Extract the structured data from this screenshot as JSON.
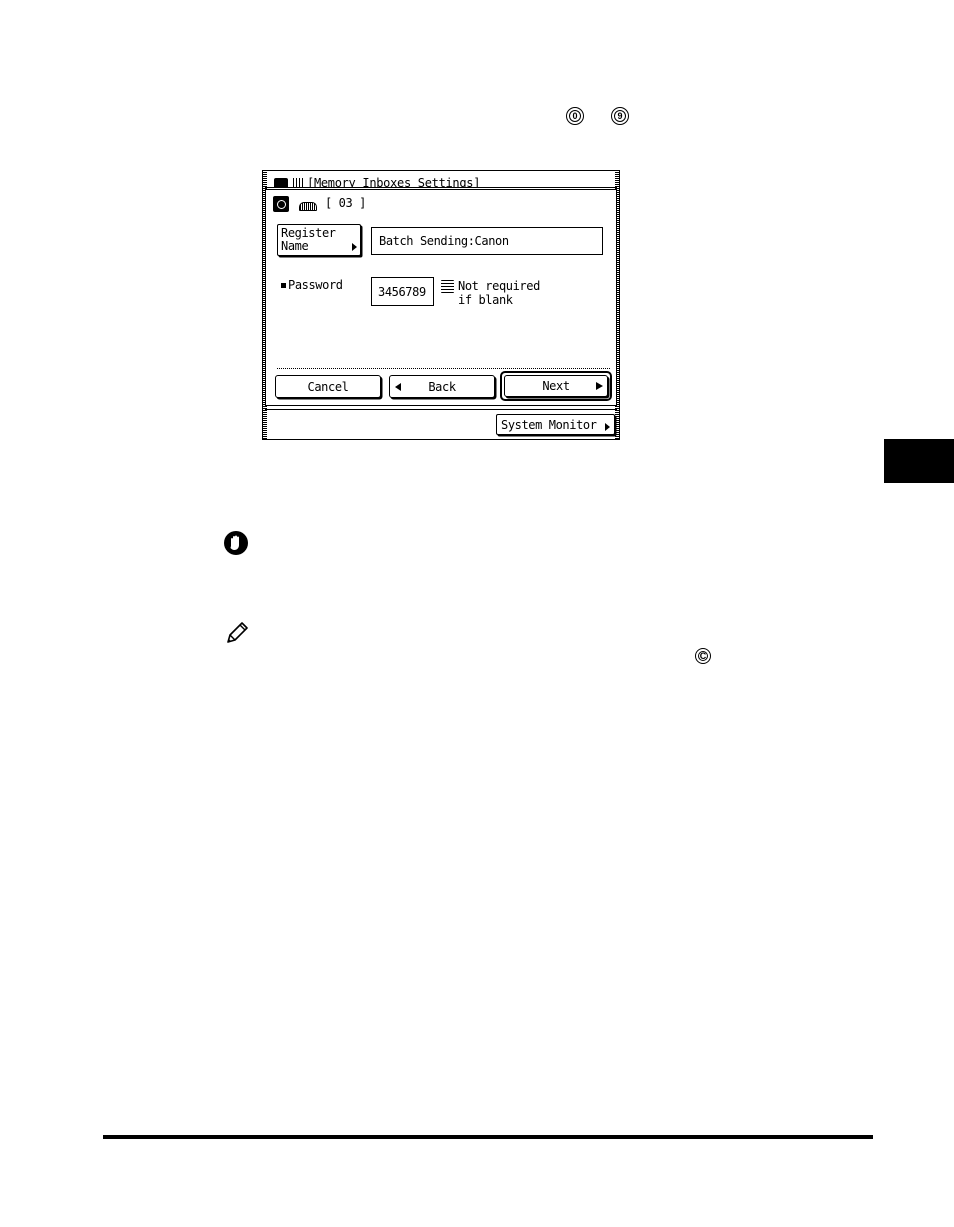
{
  "keys": {
    "start": "0",
    "end": "9",
    "clear": "C"
  },
  "screen": {
    "title": "Memory Inboxes Settings",
    "inbox_number": "[ 03 ]",
    "register_name_button": {
      "line1": "Register",
      "line2": "Name"
    },
    "name_value": "Batch Sending:Canon",
    "password_label": "Password",
    "password_value": "3456789",
    "hint_line1": "Not required",
    "hint_line2": "if blank",
    "cancel_label": "Cancel",
    "back_label": "Back",
    "next_label": "Next",
    "system_monitor_label": "System Monitor"
  },
  "icons": {
    "important": "hand-stop-icon",
    "note": "pencil-icon",
    "mode": "inbox-mode-icon",
    "inbox": "inbox-tray-icon",
    "keypad": "keypad-icon"
  },
  "colors": {
    "ink": "#000000",
    "paper": "#ffffff"
  }
}
